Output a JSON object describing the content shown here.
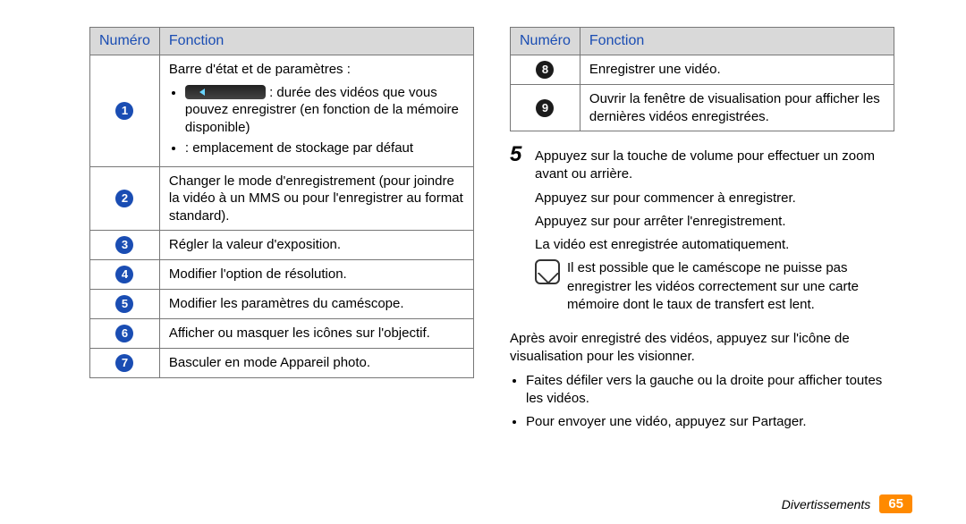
{
  "left": {
    "table": {
      "headers": [
        "Numéro",
        "Fonction"
      ],
      "rows": [
        {
          "n": "1",
          "title": "Barre d'état et de paramètres :",
          "bulleted": true,
          "bullets": [
            " : durée des vidéos que vous pouvez enregistrer (en fonction de la mémoire disponible)",
            " : emplacement de stockage par défaut"
          ]
        },
        {
          "n": "2",
          "text": "Changer le mode d'enregistrement (pour joindre la vidéo à un MMS ou pour l'enregistrer au format standard)."
        },
        {
          "n": "3",
          "text": "Régler la valeur d'exposition."
        },
        {
          "n": "4",
          "text": "Modifier l'option de résolution."
        },
        {
          "n": "5",
          "text": "Modifier les paramètres du caméscope."
        },
        {
          "n": "6",
          "text": "Afficher ou masquer les icônes sur l'objectif."
        },
        {
          "n": "7",
          "text": "Basculer en mode Appareil photo."
        }
      ]
    }
  },
  "right": {
    "table": {
      "headers": [
        "Numéro",
        "Fonction"
      ],
      "rows": [
        {
          "n": "8",
          "text": "Enregistrer une vidéo."
        },
        {
          "n": "9",
          "text": "Ouvrir la fenêtre de visualisation pour afficher les dernières vidéos enregistrées."
        }
      ]
    },
    "step5": {
      "num": "5",
      "line1": "Appuyez sur la touche de volume pour effectuer un zoom avant ou arrière.",
      "line2": "Appuyez sur    pour commencer à enregistrer.",
      "line3": "Appuyez sur    pour arrêter l'enregistrement.",
      "line4": "La vidéo est enregistrée automatiquement.",
      "note": "Il est possible que le caméscope ne puisse pas enregistrer les vidéos correctement sur une carte mémoire dont le taux de transfert est lent."
    },
    "after": {
      "intro": "Après avoir enregistré des vidéos, appuyez sur l'icône de visualisation pour les visionner.",
      "bullets": [
        "Faites défiler vers la gauche ou la droite pour afficher toutes les vidéos.",
        "Pour envoyer une vidéo, appuyez sur Partager."
      ]
    }
  },
  "footer": {
    "section": "Divertissements",
    "page": "65"
  }
}
